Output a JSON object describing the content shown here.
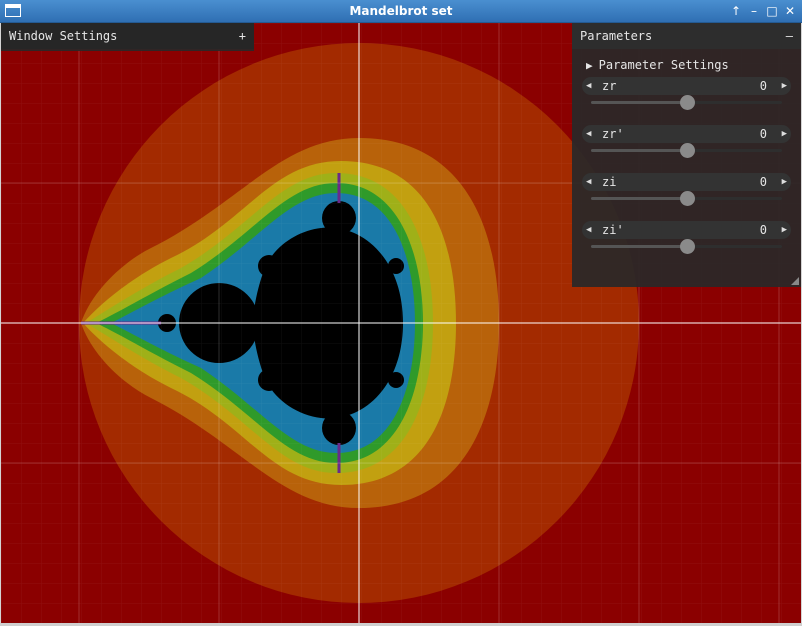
{
  "window": {
    "title": "Mandelbrot set",
    "buttons": [
      "↑",
      "–",
      "□",
      "✕"
    ]
  },
  "window_settings_panel": {
    "title": "Window Settings",
    "toggle": "+"
  },
  "parameters_panel": {
    "title": "Parameters",
    "toggle": "–",
    "section_label": "Parameter Settings",
    "section_icon": "triangle-right-icon",
    "params": [
      {
        "label": "zr",
        "value": "0",
        "level": 0.5
      },
      {
        "label": "zr'",
        "value": "0",
        "level": 0.5
      },
      {
        "label": "zi",
        "value": "0",
        "level": 0.5
      },
      {
        "label": "zi'",
        "value": "0",
        "level": 0.5
      }
    ]
  },
  "colors": {
    "background_red": "#8b0000",
    "set_black": "#000000",
    "axis_line": "#ffffff"
  }
}
